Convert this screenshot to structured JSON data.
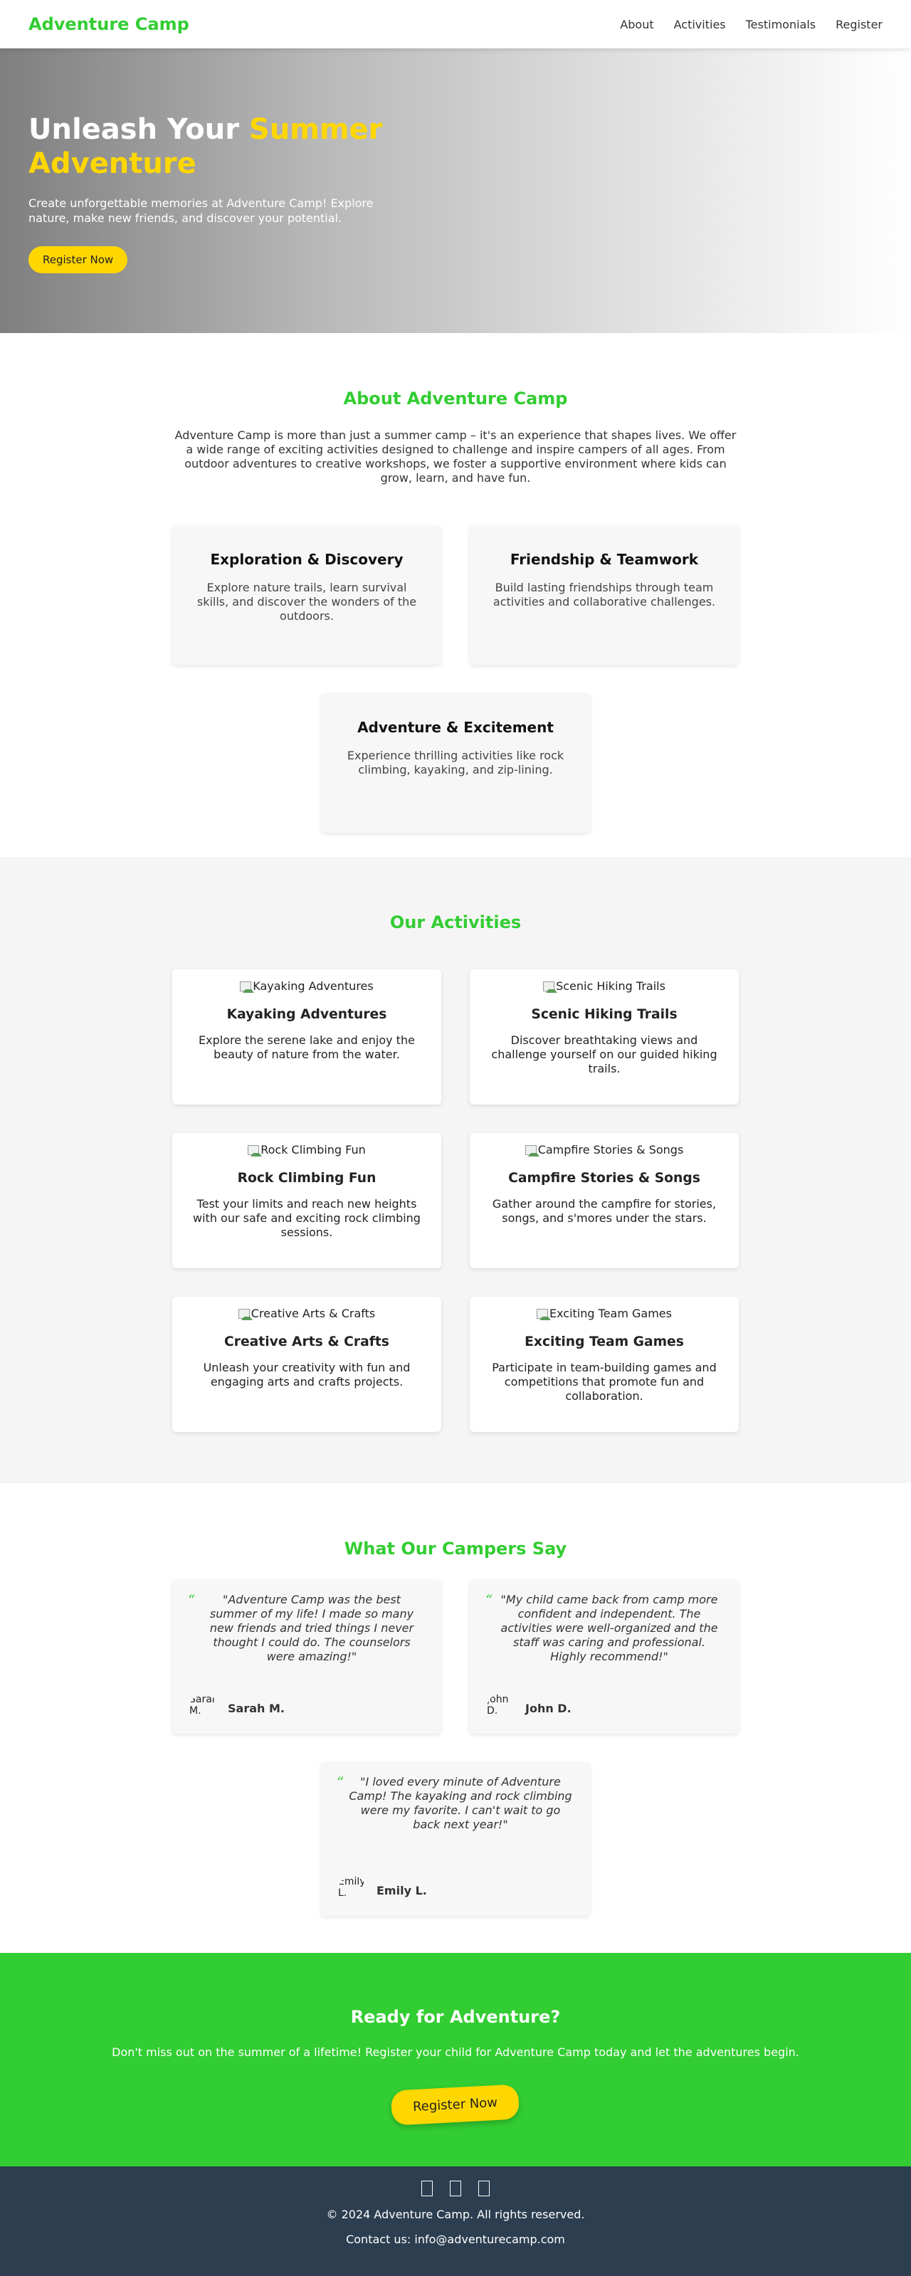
{
  "header": {
    "logo": "Adventure Camp",
    "nav": [
      "About",
      "Activities",
      "Testimonials",
      "Register"
    ]
  },
  "hero": {
    "title_part1": "Unleash Your ",
    "title_accent": "Summer Adventure",
    "subtitle": "Create unforgettable memories at Adventure Camp! Explore nature, make new friends, and discover your potential.",
    "button": "Register Now"
  },
  "about": {
    "title": "About Adventure Camp",
    "intro": "Adventure Camp is more than just a summer camp – it's an experience that shapes lives. We offer a wide range of exciting activities designed to challenge and inspire campers of all ages. From outdoor adventures to creative workshops, we foster a supportive environment where kids can grow, learn, and have fun.",
    "features": [
      {
        "title": "Exploration & Discovery",
        "text": "Explore nature trails, learn survival skills, and discover the wonders of the outdoors."
      },
      {
        "title": "Friendship & Teamwork",
        "text": "Build lasting friendships through team activities and collaborative challenges."
      },
      {
        "title": "Adventure & Excitement",
        "text": "Experience thrilling activities like rock climbing, kayaking, and zip-lining."
      }
    ]
  },
  "activities": {
    "title": "Our Activities",
    "items": [
      {
        "img_alt": "Kayaking Adventures",
        "title": "Kayaking Adventures",
        "text": "Explore the serene lake and enjoy the beauty of nature from the water."
      },
      {
        "img_alt": "Scenic Hiking Trails",
        "title": "Scenic Hiking Trails",
        "text": "Discover breathtaking views and challenge yourself on our guided hiking trails."
      },
      {
        "img_alt": "Rock Climbing Fun",
        "title": "Rock Climbing Fun",
        "text": "Test your limits and reach new heights with our safe and exciting rock climbing sessions."
      },
      {
        "img_alt": "Campfire Stories & Songs",
        "title": "Campfire Stories & Songs",
        "text": "Gather around the campfire for stories, songs, and s'mores under the stars."
      },
      {
        "img_alt": "Creative Arts & Crafts",
        "title": "Creative Arts & Crafts",
        "text": "Unleash your creativity with fun and engaging arts and crafts projects."
      },
      {
        "img_alt": "Exciting Team Games",
        "title": "Exciting Team Games",
        "text": "Participate in team-building games and competitions that promote fun and collaboration."
      }
    ]
  },
  "testimonials": {
    "title": "What Our Campers Say",
    "quote_mark": "“",
    "items": [
      {
        "quote": "\"Adventure Camp was the best summer of my life! I made so many new friends and tried things I never thought I could do. The counselors were amazing!\"",
        "avatar_alt": "Sarah M.",
        "name": "Sarah M."
      },
      {
        "quote": "\"My child came back from camp more confident and independent. The activities were well-organized and the staff was caring and professional. Highly recommend!\"",
        "avatar_alt": "John D.",
        "name": "John D."
      },
      {
        "quote": "\"I loved every minute of Adventure Camp! The kayaking and rock climbing were my favorite. I can't wait to go back next year!\"",
        "avatar_alt": "Emily L.",
        "name": "Emily L."
      }
    ]
  },
  "cta": {
    "title": "Ready for Adventure?",
    "text": "Don't miss out on the summer of a lifetime! Register your child for Adventure Camp today and let the adventures begin.",
    "button": "Register Now"
  },
  "footer": {
    "social_icons": [
      "facebook-icon",
      "twitter-icon",
      "instagram-icon"
    ],
    "copyright": "© 2024 Adventure Camp. All rights reserved.",
    "contact": "Contact us: info@adventurecamp.com"
  },
  "colors": {
    "brand_green": "#32cd32",
    "accent_yellow": "#ffd700",
    "footer_bg": "#2c3e50"
  }
}
